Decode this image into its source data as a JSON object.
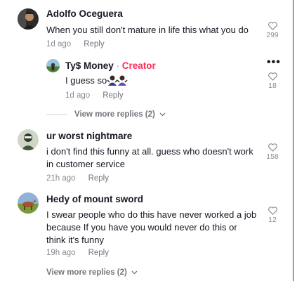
{
  "comments": [
    {
      "username": "Adolfo Oceguera",
      "text": "When you still don't mature in life this what you do",
      "time": "1d ago",
      "reply_label": "Reply",
      "likes": "299",
      "avatar_icon": "avatar-man-dark"
    },
    {
      "username": "ur worst nightmare",
      "text": "i don't find this funny at all. guess who doesn't work in customer service",
      "time": "21h ago",
      "reply_label": "Reply",
      "likes": "158",
      "avatar_icon": "avatar-person-green"
    },
    {
      "username": "Hedy of mount sword",
      "text": "I swear people who do this have never worked a job because If you have you would never do this or think it's funny",
      "time": "19h ago",
      "reply_label": "Reply",
      "likes": "12",
      "avatar_icon": "avatar-horse-field"
    }
  ],
  "creator_reply": {
    "username": "Ty$ Money",
    "separator": "·",
    "badge": "Creator",
    "text": "I guess so",
    "emoji": "shrugging-people-emoji",
    "time": "1d ago",
    "reply_label": "Reply",
    "likes": "18",
    "avatar_icon": "avatar-landscape"
  },
  "view_more": [
    {
      "label": "View more replies (2)"
    },
    {
      "label": "View more replies (2)"
    }
  ],
  "more_options": "•••",
  "colors": {
    "creator": "#fe2c55",
    "muted": "#8a8b91",
    "text": "#161823"
  }
}
